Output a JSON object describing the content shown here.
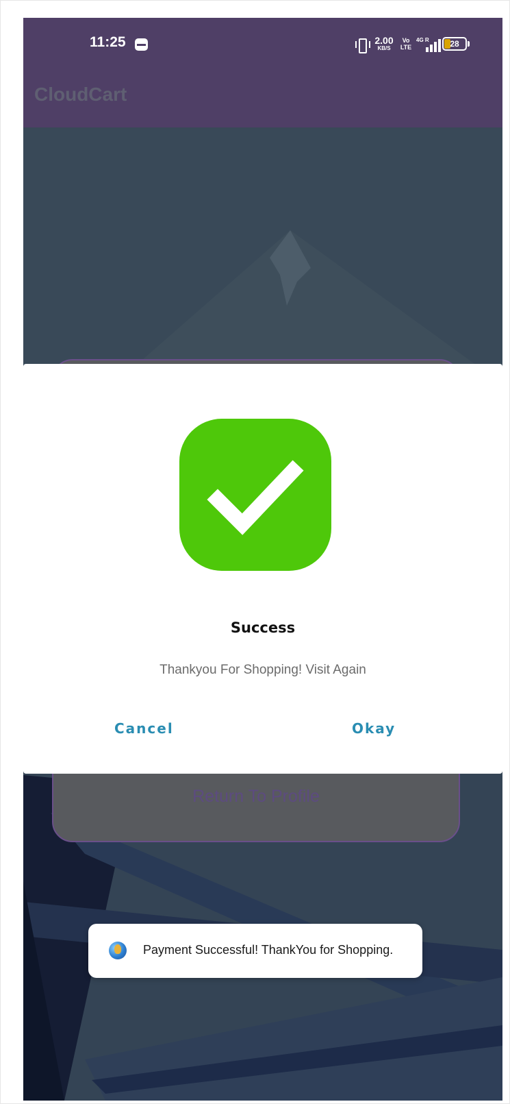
{
  "status_bar": {
    "time": "11:25",
    "network_speed": "2.00",
    "network_speed_unit": "KB/S",
    "volte_label": "Vo LTE",
    "signal_label": "4G R",
    "battery_level": "28"
  },
  "app_bar": {
    "title": "CloudCart"
  },
  "background_card": {
    "return_button_label": "Return To Profile"
  },
  "dialog": {
    "icon": "checkmark-icon",
    "title": "Success",
    "message": "Thankyou For Shopping! Visit Again",
    "cancel_label": "Cancel",
    "okay_label": "Okay"
  },
  "toast": {
    "icon": "app-icon",
    "message": "Payment Successful! ThankYou for Shopping."
  },
  "colors": {
    "app_bar": "#4f3f66",
    "success_green": "#4ec80a",
    "dialog_button": "#2a8db2"
  }
}
